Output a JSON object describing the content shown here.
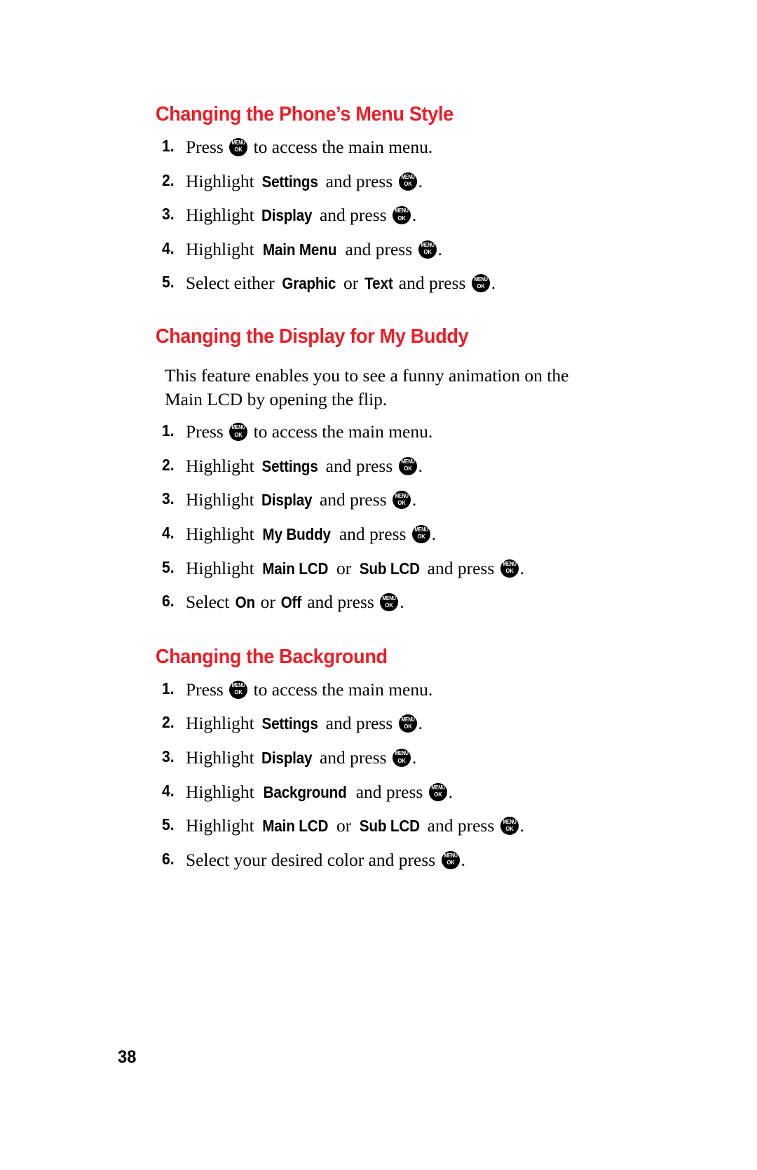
{
  "page": {
    "number": "38",
    "accent_color": "#ee1c25",
    "text_color": "#000000",
    "background_color": "#ffffff"
  },
  "key_icon": {
    "name": "menu-ok-key-icon",
    "top_label": "MENU",
    "bottom_label": "OK"
  },
  "sections": [
    {
      "heading": "Changing the Phone’s Menu Style",
      "intro": null,
      "steps": [
        {
          "num": "1.",
          "parts": [
            {
              "t": "text",
              "v": "Press "
            },
            {
              "t": "key"
            },
            {
              "t": "text",
              "v": " to access the main menu."
            }
          ]
        },
        {
          "num": "2.",
          "parts": [
            {
              "t": "text",
              "v": "Highlight "
            },
            {
              "t": "kw",
              "v": "Settings"
            },
            {
              "t": "text",
              "v": " and press "
            },
            {
              "t": "key"
            },
            {
              "t": "text",
              "v": "."
            }
          ]
        },
        {
          "num": "3.",
          "parts": [
            {
              "t": "text",
              "v": "Highlight "
            },
            {
              "t": "kw",
              "v": "Display"
            },
            {
              "t": "text",
              "v": " and press "
            },
            {
              "t": "key"
            },
            {
              "t": "text",
              "v": "."
            }
          ]
        },
        {
          "num": "4.",
          "parts": [
            {
              "t": "text",
              "v": "Highlight "
            },
            {
              "t": "kw",
              "v": "Main Menu"
            },
            {
              "t": "text",
              "v": " and press "
            },
            {
              "t": "key"
            },
            {
              "t": "text",
              "v": "."
            }
          ]
        },
        {
          "num": "5.",
          "parts": [
            {
              "t": "text",
              "v": "Select either "
            },
            {
              "t": "kw",
              "v": "Graphic"
            },
            {
              "t": "text",
              "v": " or "
            },
            {
              "t": "kw",
              "v": "Text"
            },
            {
              "t": "text",
              "v": " and press "
            },
            {
              "t": "key"
            },
            {
              "t": "text",
              "v": "."
            }
          ]
        }
      ]
    },
    {
      "heading": "Changing the Display for My Buddy",
      "intro": "This feature enables you to see a funny animation on the Main LCD by opening the flip.",
      "steps": [
        {
          "num": "1.",
          "parts": [
            {
              "t": "text",
              "v": "Press "
            },
            {
              "t": "key"
            },
            {
              "t": "text",
              "v": " to access the main menu."
            }
          ]
        },
        {
          "num": "2.",
          "parts": [
            {
              "t": "text",
              "v": "Highlight "
            },
            {
              "t": "kw",
              "v": "Settings"
            },
            {
              "t": "text",
              "v": " and press "
            },
            {
              "t": "key"
            },
            {
              "t": "text",
              "v": "."
            }
          ]
        },
        {
          "num": "3.",
          "parts": [
            {
              "t": "text",
              "v": "Highlight "
            },
            {
              "t": "kw",
              "v": "Display"
            },
            {
              "t": "text",
              "v": " and press "
            },
            {
              "t": "key"
            },
            {
              "t": "text",
              "v": "."
            }
          ]
        },
        {
          "num": "4.",
          "parts": [
            {
              "t": "text",
              "v": "Highlight "
            },
            {
              "t": "kw",
              "v": "My Buddy"
            },
            {
              "t": "text",
              "v": " and press "
            },
            {
              "t": "key"
            },
            {
              "t": "text",
              "v": "."
            }
          ]
        },
        {
          "num": "5.",
          "parts": [
            {
              "t": "text",
              "v": "Highlight "
            },
            {
              "t": "kw",
              "v": "Main LCD"
            },
            {
              "t": "text",
              "v": " or "
            },
            {
              "t": "kw",
              "v": "Sub LCD"
            },
            {
              "t": "text",
              "v": " and press "
            },
            {
              "t": "key"
            },
            {
              "t": "text",
              "v": "."
            }
          ]
        },
        {
          "num": "6.",
          "parts": [
            {
              "t": "text",
              "v": "Select "
            },
            {
              "t": "kw",
              "v": "On"
            },
            {
              "t": "text",
              "v": " or "
            },
            {
              "t": "kw",
              "v": "Off"
            },
            {
              "t": "text",
              "v": " and press "
            },
            {
              "t": "key"
            },
            {
              "t": "text",
              "v": "."
            }
          ]
        }
      ]
    },
    {
      "heading": "Changing the Background",
      "intro": null,
      "steps": [
        {
          "num": "1.",
          "parts": [
            {
              "t": "text",
              "v": "Press "
            },
            {
              "t": "key"
            },
            {
              "t": "text",
              "v": " to access the main menu."
            }
          ]
        },
        {
          "num": "2.",
          "parts": [
            {
              "t": "text",
              "v": "Highlight "
            },
            {
              "t": "kw",
              "v": "Settings"
            },
            {
              "t": "text",
              "v": " and press "
            },
            {
              "t": "key"
            },
            {
              "t": "text",
              "v": "."
            }
          ]
        },
        {
          "num": "3.",
          "parts": [
            {
              "t": "text",
              "v": "Highlight "
            },
            {
              "t": "kw",
              "v": "Display"
            },
            {
              "t": "text",
              "v": " and press "
            },
            {
              "t": "key"
            },
            {
              "t": "text",
              "v": "."
            }
          ]
        },
        {
          "num": "4.",
          "parts": [
            {
              "t": "text",
              "v": "Highlight "
            },
            {
              "t": "kw",
              "v": "Background"
            },
            {
              "t": "text",
              "v": " and press "
            },
            {
              "t": "key"
            },
            {
              "t": "text",
              "v": "."
            }
          ]
        },
        {
          "num": "5.",
          "parts": [
            {
              "t": "text",
              "v": "Highlight "
            },
            {
              "t": "kw",
              "v": "Main LCD"
            },
            {
              "t": "text",
              "v": " or "
            },
            {
              "t": "kw",
              "v": "Sub LCD"
            },
            {
              "t": "text",
              "v": " and press "
            },
            {
              "t": "key"
            },
            {
              "t": "text",
              "v": "."
            }
          ]
        },
        {
          "num": "6.",
          "parts": [
            {
              "t": "text",
              "v": "Select your desired color and press "
            },
            {
              "t": "key"
            },
            {
              "t": "text",
              "v": "."
            }
          ]
        }
      ]
    }
  ]
}
